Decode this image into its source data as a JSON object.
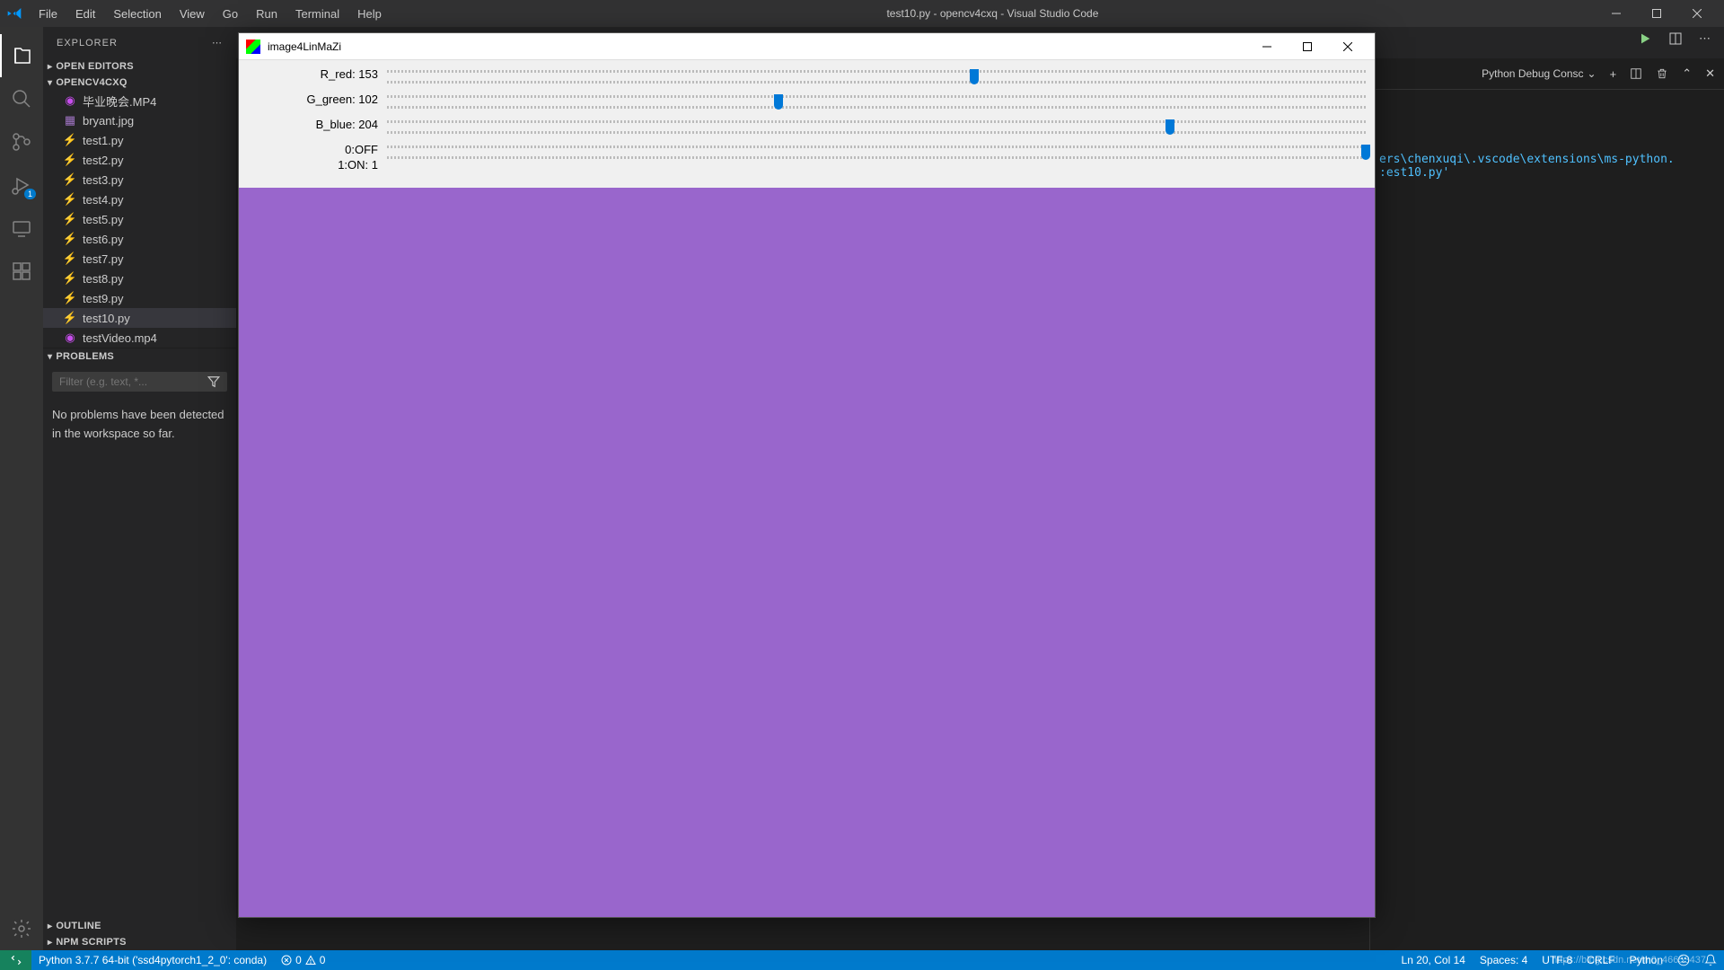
{
  "titlebar": {
    "menus": [
      "File",
      "Edit",
      "Selection",
      "View",
      "Go",
      "Run",
      "Terminal",
      "Help"
    ],
    "title": "test10.py - opencv4cxq - Visual Studio Code"
  },
  "sidebar": {
    "title": "EXPLORER",
    "sections": {
      "open_editors": "OPEN EDITORS",
      "folder": "OPENCV4CXQ",
      "outline": "OUTLINE",
      "npm": "NPM SCRIPTS",
      "problems": "PROBLEMS"
    },
    "files": [
      {
        "name": "毕业晚会.MP4",
        "icon": "video",
        "modified": true
      },
      {
        "name": "bryant.jpg",
        "icon": "image",
        "modified": false
      },
      {
        "name": "test1.py",
        "icon": "python",
        "modified": false
      },
      {
        "name": "test2.py",
        "icon": "python",
        "modified": false
      },
      {
        "name": "test3.py",
        "icon": "python",
        "modified": false
      },
      {
        "name": "test4.py",
        "icon": "python",
        "modified": false
      },
      {
        "name": "test5.py",
        "icon": "python",
        "modified": false
      },
      {
        "name": "test6.py",
        "icon": "python",
        "modified": false
      },
      {
        "name": "test7.py",
        "icon": "python",
        "modified": false
      },
      {
        "name": "test8.py",
        "icon": "python",
        "modified": false
      },
      {
        "name": "test9.py",
        "icon": "python",
        "modified": false
      },
      {
        "name": "test10.py",
        "icon": "python",
        "modified": false,
        "active": true
      },
      {
        "name": "testVideo.mp4",
        "icon": "video",
        "modified": true
      }
    ],
    "problems_filter_placeholder": "Filter (e.g. text, *...",
    "problems_text": "No problems have been detected in the workspace so far."
  },
  "cv_window": {
    "title": "image4LinMaZi",
    "trackbars": [
      {
        "label": "R_red: 153",
        "pos": 60
      },
      {
        "label": "G_green: 102",
        "pos": 40
      },
      {
        "label": "B_blue: 204",
        "pos": 80
      },
      {
        "label": "0:OFF\n1:ON: 1",
        "pos": 100
      }
    ],
    "image_color": "#9966cc"
  },
  "panel": {
    "tab_label": "Python Debug Consc",
    "lines": [
      "",
      "",
      "",
      "ers\\chenxuqi\\.vscode\\extensions\\ms-python.",
      ":est10.py'"
    ]
  },
  "statusbar": {
    "python": "Python 3.7.7 64-bit ('ssd4pytorch1_2_0': conda)",
    "errors": "0",
    "warnings": "0",
    "cursor": "Ln 20, Col 14",
    "spaces": "Spaces: 4",
    "encoding": "UTF-8",
    "eol": "CRLF",
    "lang": "Python",
    "watermark": "https://blog.csdn.net/m0_46653437"
  },
  "activity_badge": "1"
}
